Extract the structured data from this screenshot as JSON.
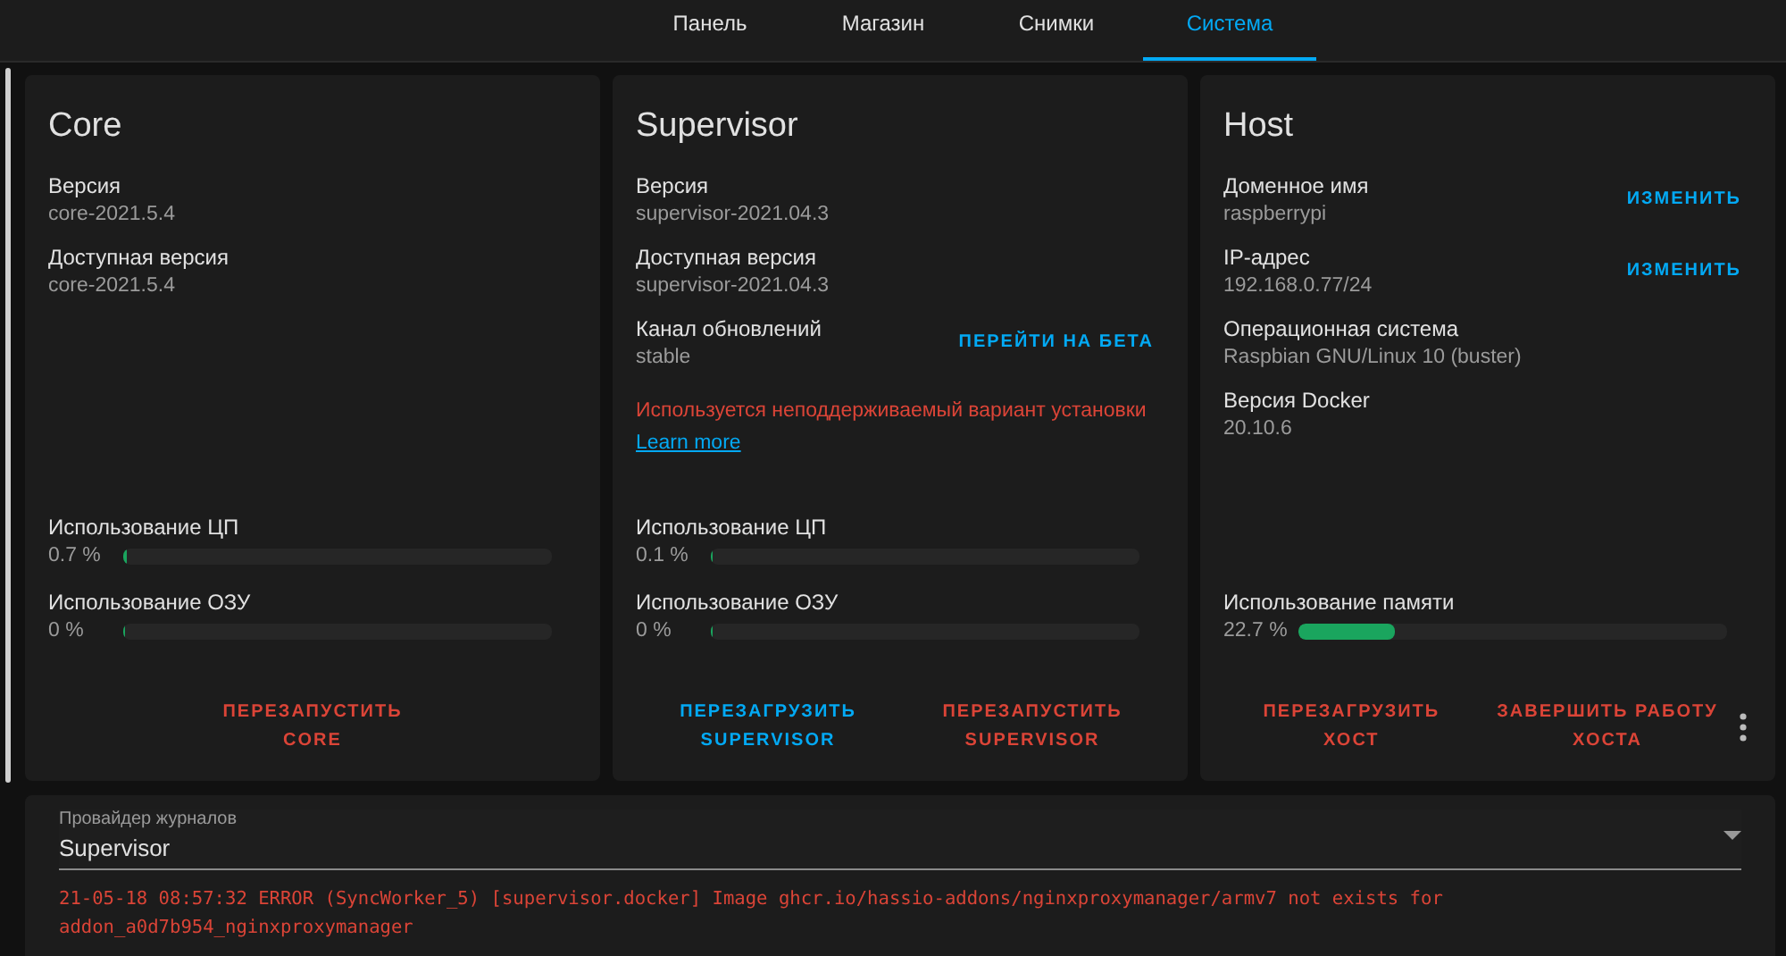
{
  "tabs": [
    {
      "label": "Панель",
      "selected": false
    },
    {
      "label": "Магазин",
      "selected": false
    },
    {
      "label": "Снимки",
      "selected": false
    },
    {
      "label": "Система",
      "selected": true
    }
  ],
  "cards": [
    {
      "title": "Core",
      "info": [
        {
          "label": "Версия",
          "value": "core-2021.5.4"
        },
        {
          "label": "Доступная версия",
          "value": "core-2021.5.4"
        }
      ],
      "meters": [
        {
          "label": "Использование ЦП",
          "reading": "0.7 %",
          "level": 0.007
        },
        {
          "label": "Использование ОЗУ",
          "reading": "0 %",
          "level": 0
        }
      ],
      "actions": [
        {
          "label": "ПЕРЕЗАПУСТИТЬ CORE",
          "kind": "danger"
        }
      ],
      "overflow_menu": false
    },
    {
      "title": "Supervisor",
      "info": [
        {
          "label": "Версия",
          "value": "supervisor-2021.04.3"
        },
        {
          "label": "Доступная версия",
          "value": "supervisor-2021.04.3"
        },
        {
          "label": "Канал обновлений",
          "value": "stable",
          "action": "ПЕРЕЙТИ НА БЕТА"
        }
      ],
      "warning": {
        "text": "Используется неподдерживаемый вариант установки",
        "link": "Learn more"
      },
      "meters": [
        {
          "label": "Использование ЦП",
          "reading": "0.1 %",
          "level": 0.001
        },
        {
          "label": "Использование ОЗУ",
          "reading": "0 %",
          "level": 0
        }
      ],
      "actions": [
        {
          "label": "ПЕРЕЗАГРУЗИТЬ SUPERVISOR",
          "kind": "primary"
        },
        {
          "label": "ПЕРЕЗАПУСТИТЬ SUPERVISOR",
          "kind": "danger"
        }
      ],
      "overflow_menu": false
    },
    {
      "title": "Host",
      "info": [
        {
          "label": "Доменное имя",
          "value": "raspberrypi",
          "action": "ИЗМЕНИТЬ"
        },
        {
          "label": "IP-адрес",
          "value": "192.168.0.77/24",
          "action": "ИЗМЕНИТЬ"
        },
        {
          "label": "Операционная система",
          "value": "Raspbian GNU/Linux 10 (buster)"
        },
        {
          "label": "Версия Docker",
          "value": "20.10.6"
        }
      ],
      "meters": [
        {
          "label": "Использование памяти",
          "reading": "22.7 %",
          "level": 0.227
        }
      ],
      "actions": [
        {
          "label": "ПЕРЕЗАГРУЗИТЬ ХОСТ",
          "kind": "danger"
        },
        {
          "label": "ЗАВЕРШИТЬ РАБОТУ ХОСТА",
          "kind": "danger"
        }
      ],
      "overflow_menu": true
    }
  ],
  "logs": {
    "provider_label": "Провайдер журналов",
    "provider": "Supervisor",
    "lines": [
      "21-05-18 08:57:32 ERROR (SyncWorker_5) [supervisor.docker] Image ghcr.io/hassio-addons/nginxproxymanager/armv7 not exists for addon_a0d7b954_nginxproxymanager"
    ]
  }
}
